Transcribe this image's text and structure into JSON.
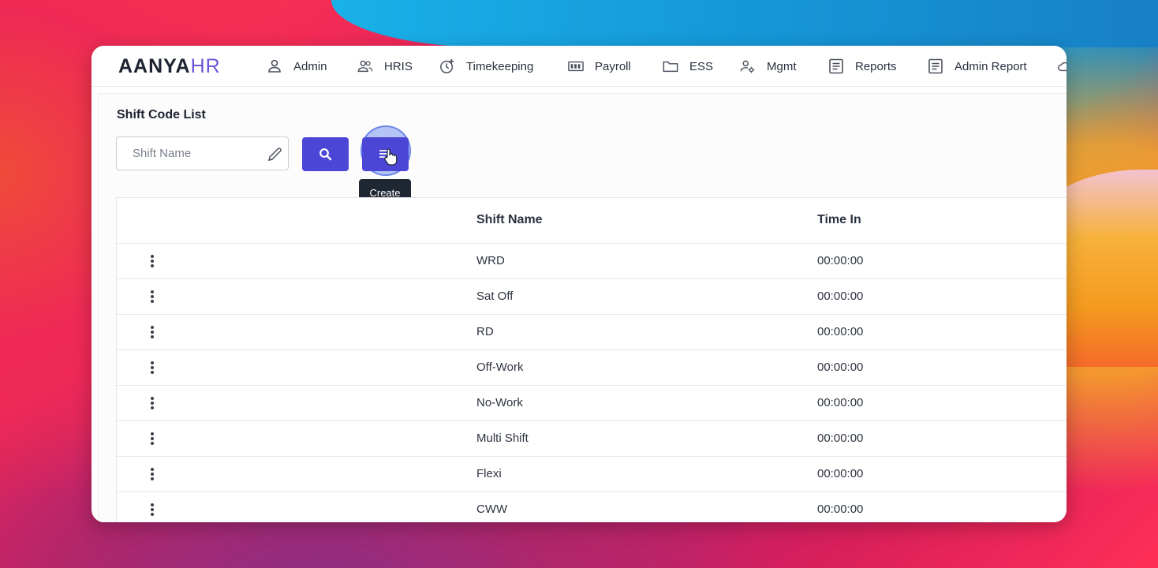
{
  "app": {
    "logo_main": "AANYA",
    "logo_suffix": "HR"
  },
  "nav": {
    "items": [
      {
        "label": "Admin",
        "icon": "person-icon"
      },
      {
        "label": "HRIS",
        "icon": "people-icon"
      },
      {
        "label": "Timekeeping",
        "icon": "clock-plus-icon"
      },
      {
        "label": "Payroll",
        "icon": "money-icon"
      },
      {
        "label": "ESS",
        "icon": "folder-icon"
      },
      {
        "label": "Mgmt",
        "icon": "user-gear-icon"
      },
      {
        "label": "Reports",
        "icon": "document-icon"
      },
      {
        "label": "Admin Report",
        "icon": "document-icon"
      }
    ]
  },
  "page": {
    "title": "Shift Code List"
  },
  "search": {
    "placeholder": "Shift Name",
    "value": ""
  },
  "create_tooltip": "Create",
  "table": {
    "columns": [
      "",
      "Shift Name",
      "Time In"
    ],
    "rows": [
      {
        "shift_name": "WRD",
        "time_in": "00:00:00"
      },
      {
        "shift_name": "Sat Off",
        "time_in": "00:00:00"
      },
      {
        "shift_name": "RD",
        "time_in": "00:00:00"
      },
      {
        "shift_name": "Off-Work",
        "time_in": "00:00:00"
      },
      {
        "shift_name": "No-Work",
        "time_in": "00:00:00"
      },
      {
        "shift_name": "Multi Shift",
        "time_in": "00:00:00"
      },
      {
        "shift_name": "Flexi",
        "time_in": "00:00:00"
      },
      {
        "shift_name": "CWW",
        "time_in": "00:00:00"
      }
    ]
  },
  "colors": {
    "accent": "#4b46d6",
    "logo_suffix": "#6a55d8",
    "tooltip_bg": "#1f2733"
  }
}
